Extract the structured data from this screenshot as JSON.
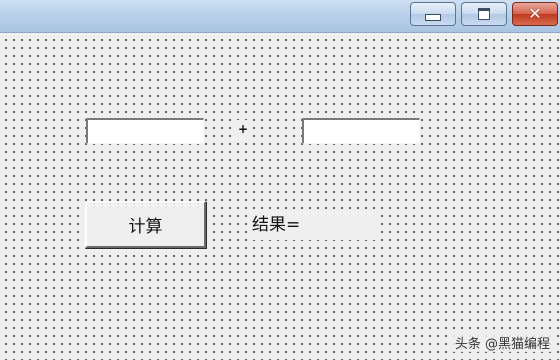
{
  "window": {
    "buttons": {
      "minimize_icon": "minimize-icon",
      "maximize_icon": "maximize-icon",
      "close_glyph": "✕"
    }
  },
  "form": {
    "input1": {
      "value": "",
      "placeholder": ""
    },
    "operator_label": "+",
    "input2": {
      "value": "",
      "placeholder": ""
    },
    "calculate_button_label": "计算",
    "result_label": "结果="
  },
  "watermark": "头条 @黑猫编程",
  "colors": {
    "titlebar": "#b9d1ea",
    "close_button": "#c0391f",
    "form_background": "#efefef",
    "grid_dots": "#4a4a4a"
  }
}
